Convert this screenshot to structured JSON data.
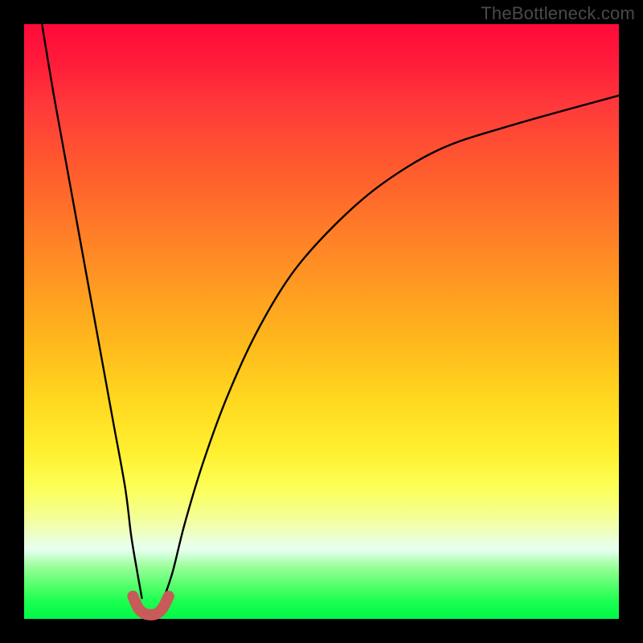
{
  "watermark": "TheBottleneck.com",
  "chart_data": {
    "type": "line",
    "title": "",
    "xlabel": "",
    "ylabel": "",
    "xlim": [
      0,
      100
    ],
    "ylim": [
      0,
      100
    ],
    "grid": false,
    "legend": false,
    "series": [
      {
        "name": "left-branch",
        "x": [
          3,
          5,
          7,
          9,
          11,
          13,
          15,
          17,
          18,
          19,
          19.8
        ],
        "values": [
          100,
          88,
          77,
          66,
          55,
          44,
          33,
          22,
          14,
          8,
          3.5
        ]
      },
      {
        "name": "right-branch",
        "x": [
          23.5,
          25,
          27,
          30,
          34,
          39,
          45,
          52,
          60,
          70,
          82,
          100
        ],
        "values": [
          3.5,
          8,
          16,
          26,
          37,
          48,
          58,
          66,
          73,
          79,
          83,
          88
        ]
      },
      {
        "name": "valley-marker",
        "x": [
          18.3,
          19.2,
          20.2,
          21.3,
          22.3,
          23.3,
          24.3
        ],
        "values": [
          3.8,
          1.8,
          0.9,
          0.7,
          0.9,
          1.8,
          3.8
        ]
      }
    ],
    "annotations": []
  },
  "colors": {
    "curve": "#000000",
    "marker": "#c85a5a",
    "frame": "#000000"
  }
}
